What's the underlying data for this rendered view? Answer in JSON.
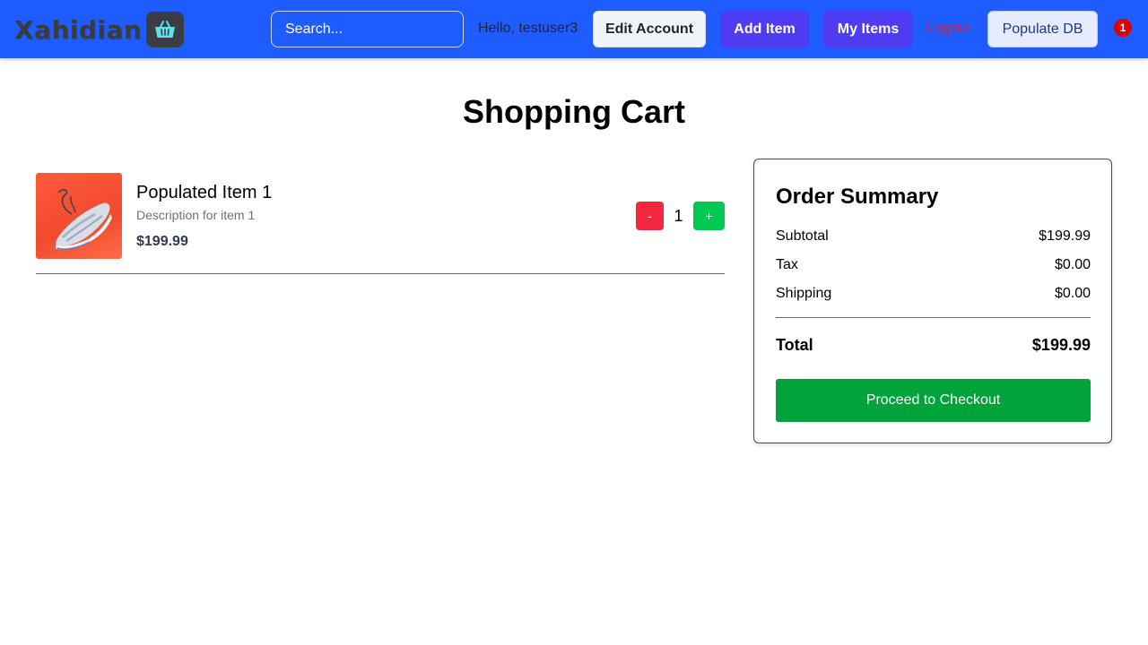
{
  "navbar": {
    "brand_name": "Xahidian",
    "brand_icon": "basket-icon",
    "search_placeholder": "Search...",
    "greeting": "Hello, testuser3",
    "edit_account_label": "Edit Account",
    "add_item_label": "Add Item",
    "my_items_label": "My Items",
    "logout_label": "Logout",
    "populate_db_label": "Populate DB",
    "cart_count": "1",
    "colors": {
      "bar": "#1f5cff",
      "primary_button": "#4f3bf2",
      "logout": "#e8182a",
      "badge": "#e10000"
    }
  },
  "page": {
    "title": "Shopping Cart"
  },
  "cart": {
    "items": [
      {
        "name": "Populated Item 1",
        "description": "Description for item 1",
        "price": "$199.99",
        "quantity": "1",
        "image": "sneaker-image",
        "decrement_label": "-",
        "increment_label": "+"
      }
    ]
  },
  "summary": {
    "title": "Order Summary",
    "subtotal_label": "Subtotal",
    "subtotal_value": "$199.99",
    "tax_label": "Tax",
    "tax_value": "$0.00",
    "shipping_label": "Shipping",
    "shipping_value": "$0.00",
    "total_label": "Total",
    "total_value": "$199.99",
    "checkout_label": "Proceed to Checkout",
    "checkout_color": "#00a33b"
  }
}
